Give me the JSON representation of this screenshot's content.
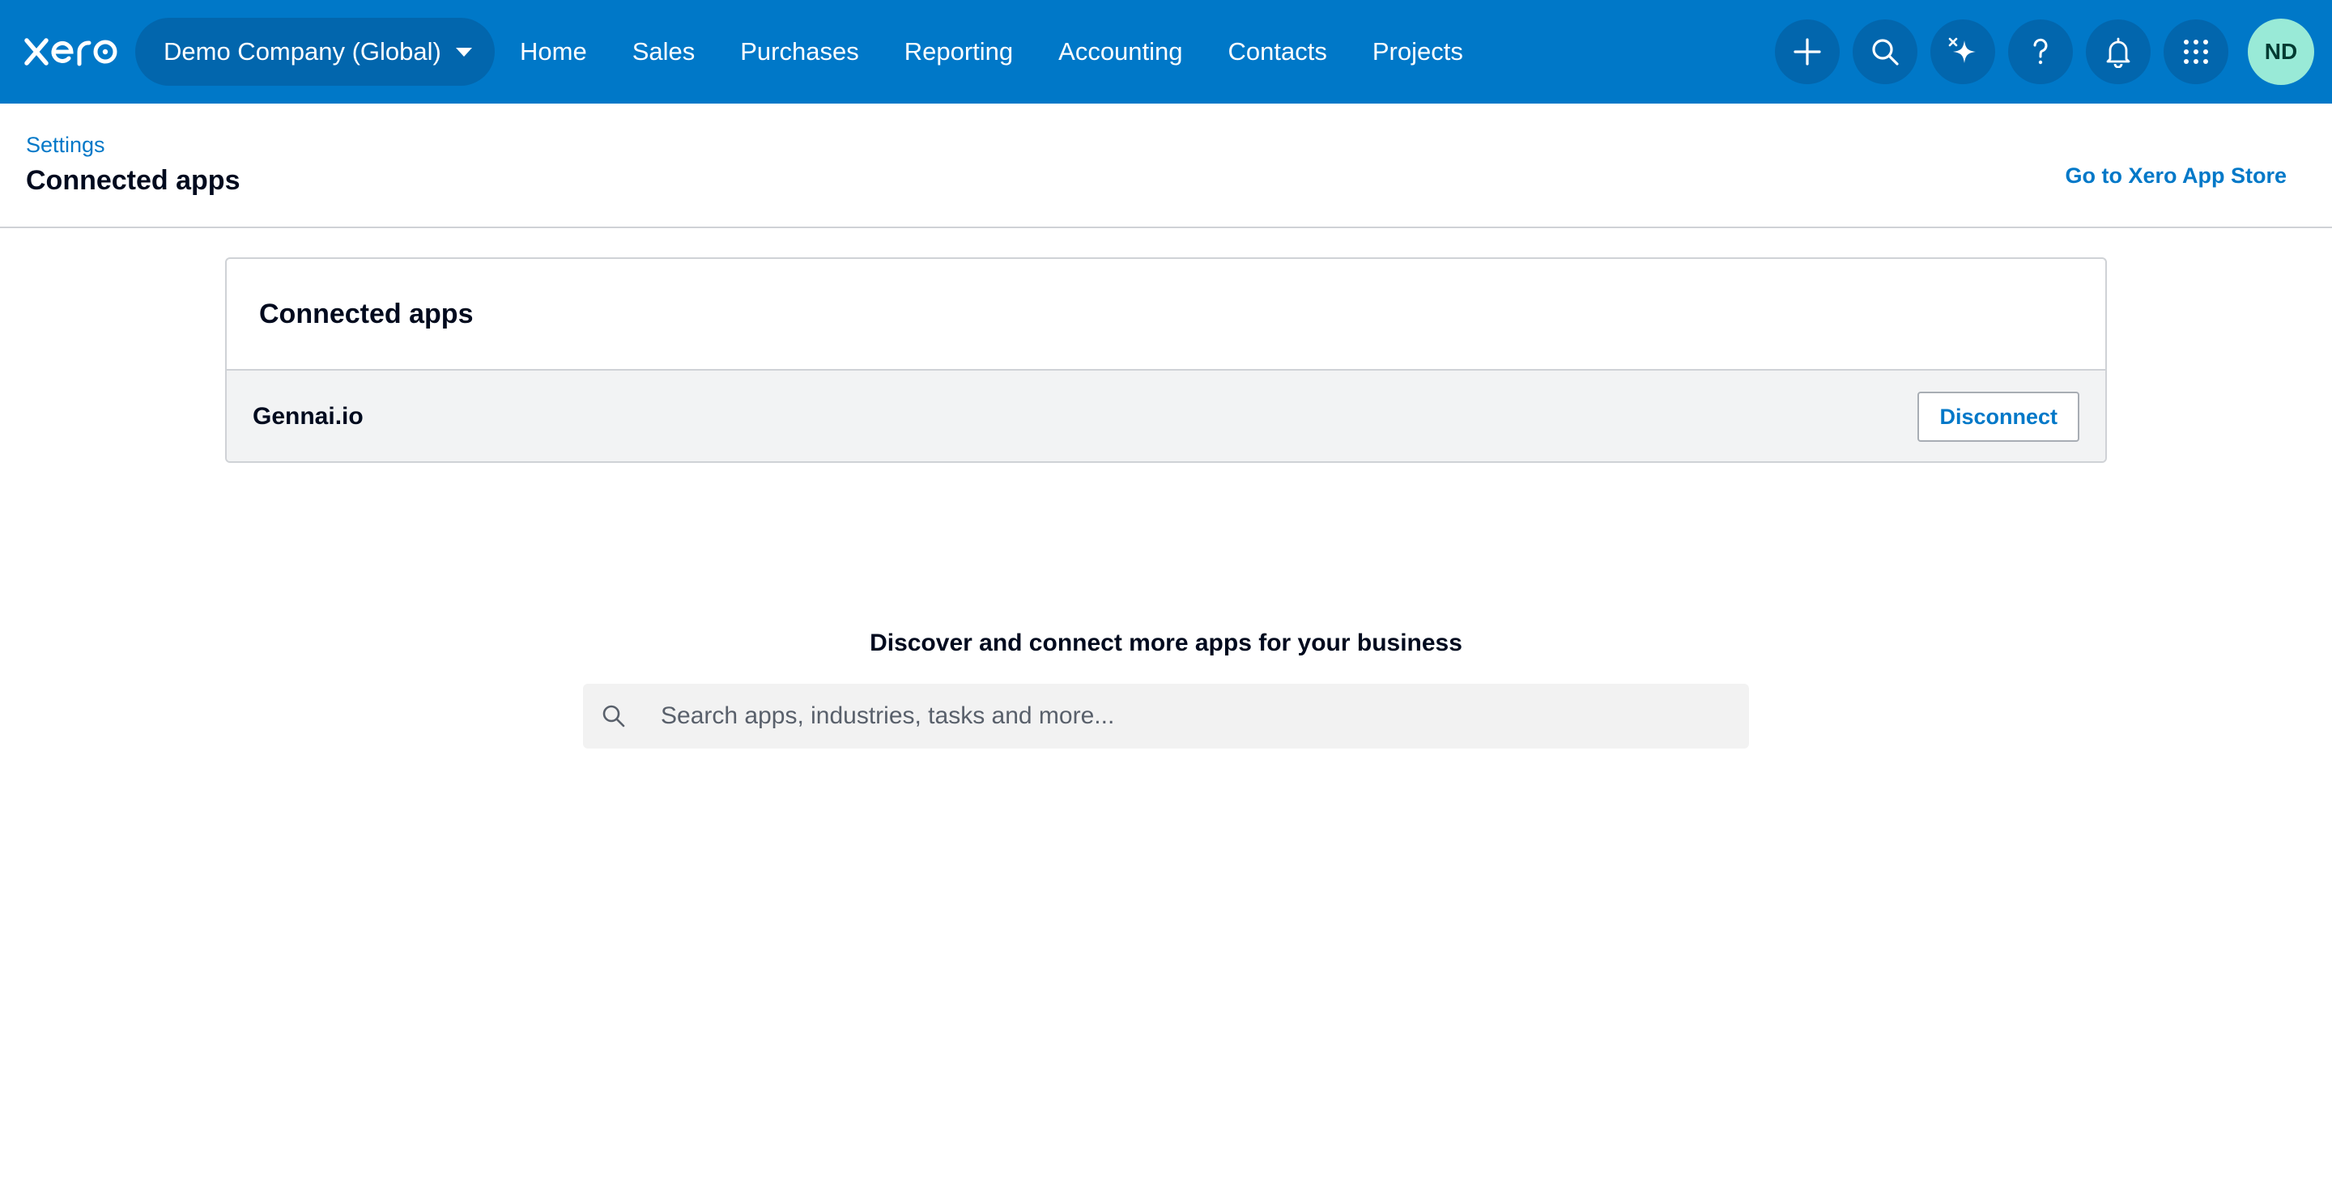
{
  "topbar": {
    "brand": "xero",
    "organisation": "Demo Company (Global)",
    "nav": [
      "Home",
      "Sales",
      "Purchases",
      "Reporting",
      "Accounting",
      "Contacts",
      "Projects"
    ],
    "icons": [
      "plus-icon",
      "search-icon",
      "sparkle-icon",
      "help-icon",
      "bell-icon",
      "app-grid-icon"
    ],
    "avatar_initials": "ND",
    "colors": {
      "bar": "#0078c8",
      "pill": "#0266ad",
      "avatar": "#99ead7"
    }
  },
  "page": {
    "breadcrumb": "Settings",
    "title": "Connected apps",
    "app_store_link": "Go to Xero App Store"
  },
  "connected": {
    "heading": "Connected apps",
    "apps": [
      {
        "name": "Gennai.io",
        "action": "Disconnect"
      }
    ]
  },
  "discover": {
    "heading": "Discover and connect more apps for your business",
    "search_placeholder": "Search apps, industries, tasks and more..."
  }
}
